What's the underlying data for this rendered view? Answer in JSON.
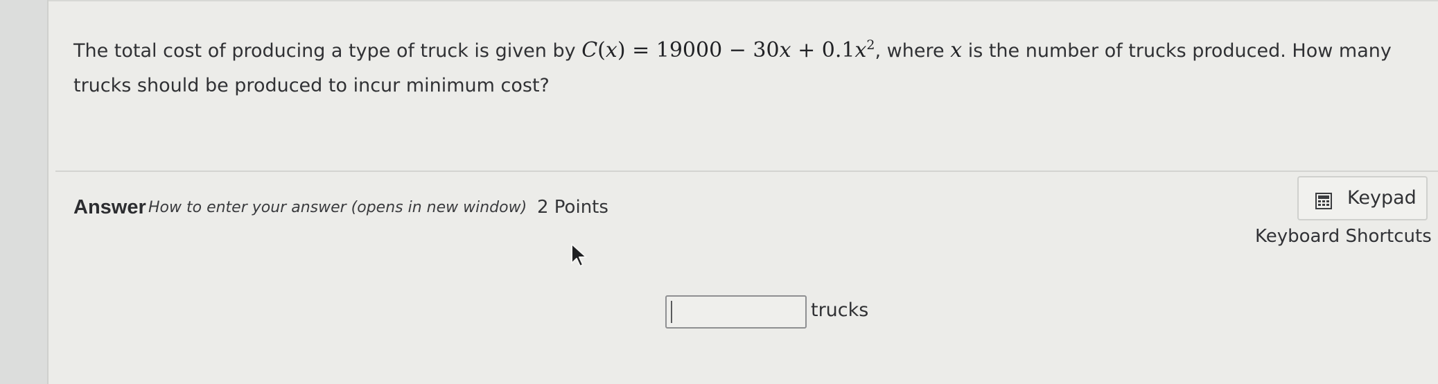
{
  "question": {
    "text_before": "The total cost of producing a type of truck is given by ",
    "formula": {
      "function_name": "C",
      "variable": "x",
      "equals": "=",
      "constant": "19000",
      "minus": "−",
      "linear_coefficient": "30",
      "plus": "+",
      "quadratic_coefficient": "0.1",
      "exponent": "2"
    },
    "text_after_formula": ", where ",
    "variable_inline": "x",
    "text_end": " is the number of trucks produced. How many trucks should be produced to incur minimum cost?"
  },
  "answer": {
    "label": "Answer",
    "help_link": "How to enter your answer (opens in new window)",
    "points": "2 Points",
    "input_value": "",
    "units": "trucks"
  },
  "toolbar": {
    "keypad_label": "Keypad",
    "keyboard_shortcuts_label": "Keyboard Shortcuts"
  },
  "icons": {
    "keypad": "calculator-icon",
    "cursor": "mouse-pointer-icon"
  }
}
